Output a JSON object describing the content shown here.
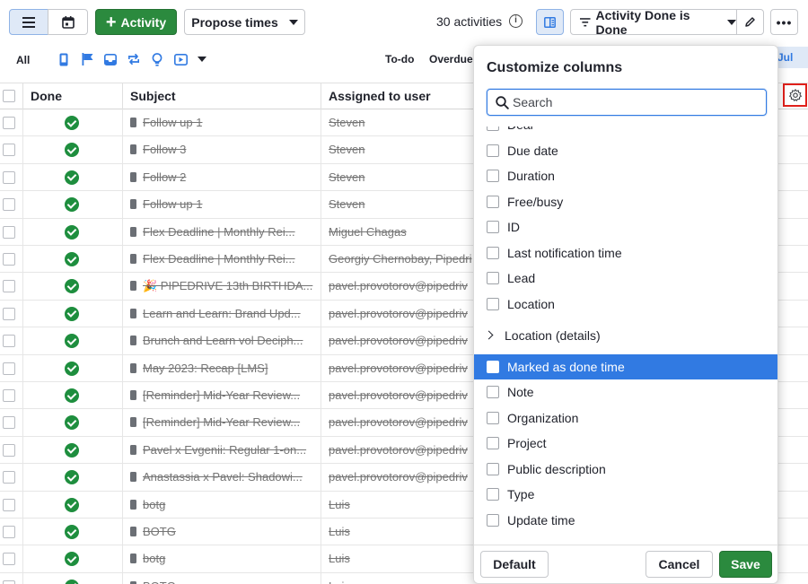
{
  "toolbar": {
    "activity_label": "Activity",
    "propose_label": "Propose times",
    "count_text": "30 activities",
    "filter_label": "Activity Done is Done"
  },
  "filters": {
    "all_label": "All",
    "todo_label": "To-do",
    "overdue_label": "Overdue",
    "month_label": "Jul",
    "type_icons": [
      "phone-icon",
      "flag-icon",
      "inbox-icon",
      "sync-icon",
      "lightbulb-icon",
      "video-icon"
    ]
  },
  "table": {
    "headers": {
      "done": "Done",
      "subject": "Subject",
      "assigned": "Assigned to user"
    },
    "rows": [
      {
        "subject": "Follow up 1",
        "assigned": "Steven"
      },
      {
        "subject": "Follow 3",
        "assigned": "Steven"
      },
      {
        "subject": "Follow 2",
        "assigned": "Steven"
      },
      {
        "subject": "Follow up 1",
        "assigned": "Steven"
      },
      {
        "subject": "Flex Deadline | Monthly Rei...",
        "assigned": "Miguel Chagas"
      },
      {
        "subject": "Flex Deadline | Monthly Rei...",
        "assigned": "Georgiy Chernobay, Pipedri"
      },
      {
        "subject": "🎉 PIPEDRIVE 13th BIRTHDA...",
        "assigned": "pavel.provotorov@pipedriv"
      },
      {
        "subject": "Learn and Learn: Brand Upd...",
        "assigned": "pavel.provotorov@pipedriv"
      },
      {
        "subject": "Brunch and Learn vol Deciph...",
        "assigned": "pavel.provotorov@pipedriv"
      },
      {
        "subject": "May 2023: Recap [LMS]",
        "assigned": "pavel.provotorov@pipedriv"
      },
      {
        "subject": "[Reminder] Mid-Year Review...",
        "assigned": "pavel.provotorov@pipedriv"
      },
      {
        "subject": "[Reminder] Mid-Year Review...",
        "assigned": "pavel.provotorov@pipedriv"
      },
      {
        "subject": "Pavel x Evgenii: Regular 1-on...",
        "assigned": "pavel.provotorov@pipedriv"
      },
      {
        "subject": "Anastassia x Pavel: Shadowi...",
        "assigned": "pavel.provotorov@pipedriv"
      },
      {
        "subject": "botg",
        "assigned": "Luis"
      },
      {
        "subject": "BOTG",
        "assigned": "Luis"
      },
      {
        "subject": "botg",
        "assigned": "Luis"
      },
      {
        "subject": "BOTG",
        "assigned": "Luis"
      }
    ]
  },
  "popover": {
    "title": "Customize columns",
    "search_placeholder": "Search",
    "options": [
      {
        "label": "Deal",
        "type": "check"
      },
      {
        "label": "Due date",
        "type": "check"
      },
      {
        "label": "Duration",
        "type": "check"
      },
      {
        "label": "Free/busy",
        "type": "check"
      },
      {
        "label": "ID",
        "type": "check"
      },
      {
        "label": "Last notification time",
        "type": "check"
      },
      {
        "label": "Lead",
        "type": "check"
      },
      {
        "label": "Location",
        "type": "check"
      },
      {
        "label": "Location (details)",
        "type": "group"
      },
      {
        "label": "Marked as done time",
        "type": "check",
        "highlighted": true
      },
      {
        "label": "Note",
        "type": "check"
      },
      {
        "label": "Organization",
        "type": "check"
      },
      {
        "label": "Project",
        "type": "check"
      },
      {
        "label": "Public description",
        "type": "check"
      },
      {
        "label": "Type",
        "type": "check"
      },
      {
        "label": "Update time",
        "type": "check"
      }
    ],
    "default_label": "Default",
    "cancel_label": "Cancel",
    "save_label": "Save"
  },
  "colors": {
    "accent": "#317ae2",
    "success": "#2b8a3e",
    "highlight_border": "#e0201b"
  }
}
